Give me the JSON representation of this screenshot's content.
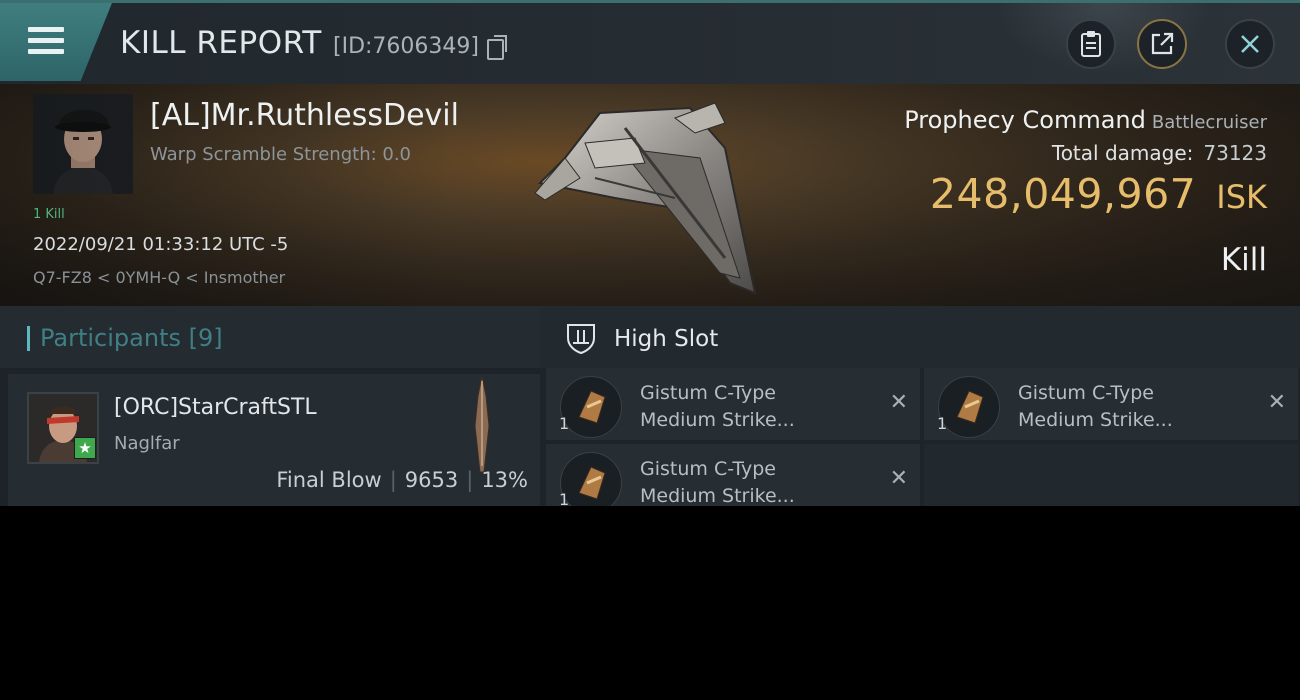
{
  "header": {
    "title": "KILL REPORT",
    "report_id": "[ID:7606349]"
  },
  "victim": {
    "name": "[AL]Mr.RuthlessDevil",
    "warp_scramble": "Warp Scramble Strength: 0.0",
    "kill_count": "1 Kill",
    "datetime": "2022/09/21 01:33:12 UTC -5",
    "location": "Q7-FZ8 < 0YMH-Q < Insmother"
  },
  "ship": {
    "name": "Prophecy Command",
    "class": "Battlecruiser",
    "total_damage_label": "Total damage:",
    "total_damage": "73123",
    "isk_value": "248,049,967",
    "isk_unit": "ISK",
    "result": "Kill"
  },
  "participants": {
    "label": "Participants [9]",
    "items": [
      {
        "name": "[ORC]StarCraftSTL",
        "ship": "Naglfar",
        "final_blow": "Final Blow",
        "damage": "9653",
        "percent": "13%"
      }
    ]
  },
  "slots": {
    "title": "High Slot",
    "items": [
      {
        "qty": "1",
        "line1": "Gistum C-Type",
        "line2": "Medium Strike..."
      },
      {
        "qty": "1",
        "line1": "Gistum C-Type",
        "line2": "Medium Strike..."
      },
      {
        "qty": "1",
        "line1": "Gistum C-Type",
        "line2": "Medium Strike..."
      }
    ]
  },
  "icons": [
    "menu-icon",
    "copy-icon",
    "clipboard-icon",
    "share-icon",
    "close-icon",
    "shield-slot-icon",
    "remove-icon"
  ],
  "colors": {
    "accent": "#3f7e80",
    "isk_gold": "#e6bd6a",
    "kill_green": "#4fb67e",
    "participants_label": "#3f7f86"
  }
}
